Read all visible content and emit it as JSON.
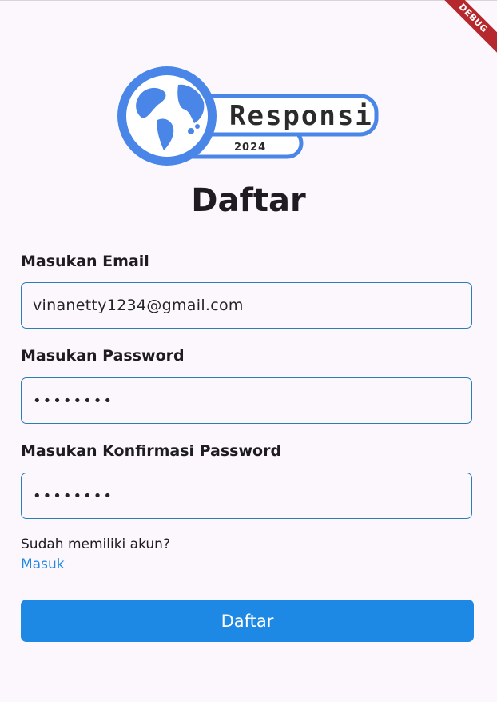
{
  "debug_banner": "DEBUG",
  "logo": {
    "text": "Responsi",
    "year": "2024",
    "color": "#4A86E8"
  },
  "page_title": "Daftar",
  "form": {
    "email": {
      "label": "Masukan Email",
      "value": "vinanetty1234@gmail.com"
    },
    "password": {
      "label": "Masukan Password",
      "value": "••••••••"
    },
    "confirm_password": {
      "label": "Masukan Konfirmasi Password",
      "value": "••••••••"
    }
  },
  "have_account_text": "Sudah memiliki akun?",
  "login_link": "Masuk",
  "submit_label": "Daftar",
  "colors": {
    "accent": "#1E88E5",
    "border": "#2B7DB8",
    "background": "#FCF7FC"
  }
}
